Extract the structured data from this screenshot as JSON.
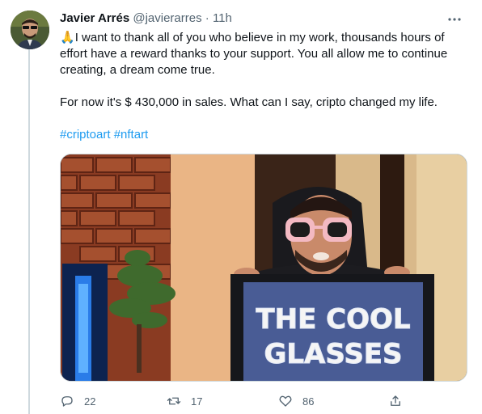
{
  "author": {
    "name": "Javier Arrés",
    "handle": "@javierarres",
    "separator": "·",
    "time": "11h"
  },
  "tweet": {
    "emoji": "🙏",
    "line1": "I want to thank all of you who believe in my work, thousands hours of effort have a reward thanks to your support. You all allow me to continue creating, a dream come true.",
    "line2": "For now it's $ 430,000 in sales. What can I say, cripto changed my life.",
    "hashtags": [
      "#criptoart",
      "#nftart"
    ]
  },
  "media": {
    "screen_text_1": "THE COOL",
    "screen_text_2": "GLASSES"
  },
  "actions": {
    "replies": "22",
    "retweets": "17",
    "likes": "86"
  },
  "icons": {
    "more": "more-horizontal-icon",
    "reply": "reply-icon",
    "retweet": "retweet-icon",
    "like": "heart-icon",
    "share": "share-icon"
  },
  "colors": {
    "link": "#1d9bf0",
    "secondary": "#536471",
    "text": "#0f1419"
  }
}
